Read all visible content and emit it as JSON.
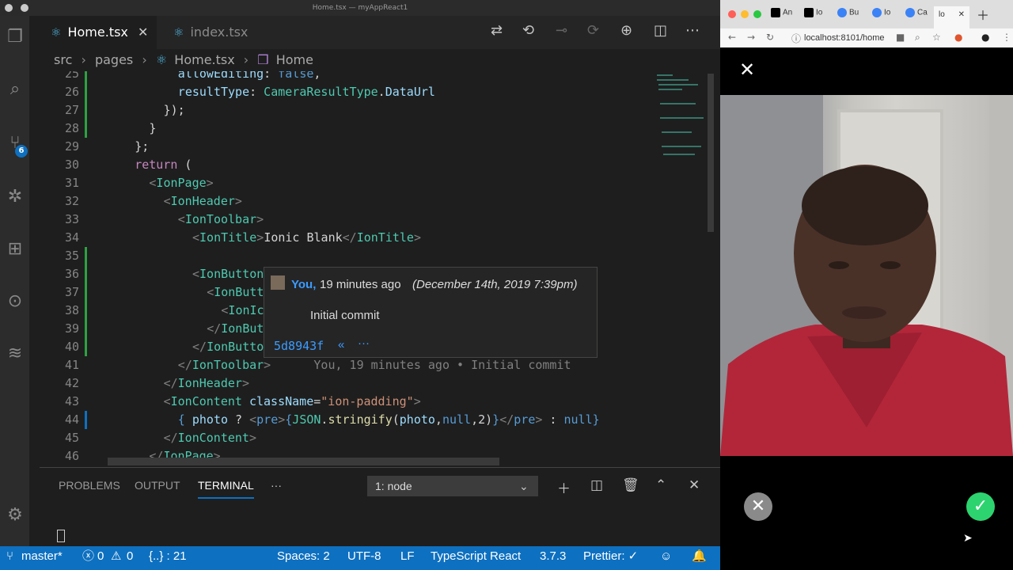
{
  "window_title": "Home.tsx — myAppReact1",
  "activity_bar": {
    "scm_badge": "6"
  },
  "tabs": [
    {
      "label": "Home.tsx",
      "active": true
    },
    {
      "label": "index.tsx",
      "active": false
    }
  ],
  "breadcrumb": {
    "parts": [
      "src",
      "pages",
      "Home.tsx",
      "Home"
    ]
  },
  "editor_lines": [
    {
      "n": "25",
      "html": "<span class='a'>allowEditing</span><span class='w'>: </span><span class='b'>false</span><span class='w'>,</span>",
      "indent": 8
    },
    {
      "n": "26",
      "html": "<span class='a'>resultType</span><span class='w'>: </span><span class='t'>CameraResultType</span><span class='w'>.</span><span class='a'>DataUrl</span>",
      "indent": 8
    },
    {
      "n": "27",
      "html": "<span class='w'>});</span>",
      "indent": 6
    },
    {
      "n": "28",
      "html": "<span class='w'>}</span>",
      "indent": 4
    },
    {
      "n": "29",
      "html": "<span class='w'>};</span>",
      "indent": 2
    },
    {
      "n": "30",
      "html": "<span class='k'>return</span><span class='w'> (</span>",
      "indent": 2
    },
    {
      "n": "31",
      "html": "<span class='p'>&lt;</span><span class='t'>IonPage</span><span class='p'>&gt;</span>",
      "indent": 4
    },
    {
      "n": "32",
      "html": "<span class='p'>&lt;</span><span class='t'>IonHeader</span><span class='p'>&gt;</span>",
      "indent": 6
    },
    {
      "n": "33",
      "html": "<span class='p'>&lt;</span><span class='t'>IonToolbar</span><span class='p'>&gt;</span>",
      "indent": 8
    },
    {
      "n": "34",
      "html": "<span class='p'>&lt;</span><span class='t'>IonTitle</span><span class='p'>&gt;</span><span class='w'>Ionic Blank</span><span class='p'>&lt;/</span><span class='t'>IonTitle</span><span class='p'>&gt;</span>",
      "indent": 10
    },
    {
      "n": "35",
      "html": "",
      "indent": 0
    },
    {
      "n": "36",
      "html": "<span class='p'>&lt;</span><span class='t'>IonButtons</span>",
      "indent": 10
    },
    {
      "n": "37",
      "html": "<span class='p'>&lt;</span><span class='t'>IonButto</span>",
      "indent": 12
    },
    {
      "n": "38",
      "html": "<span class='p'>&lt;</span><span class='t'>IonIco</span>",
      "indent": 14
    },
    {
      "n": "39",
      "html": "<span class='p'>&lt;/</span><span class='t'>IonButt</span>",
      "indent": 12
    },
    {
      "n": "40",
      "html": "<span class='p'>&lt;/</span><span class='t'>IonButton</span>",
      "indent": 10
    },
    {
      "n": "41",
      "html": "<span class='p'>&lt;/</span><span class='t'>IonToolbar</span><span class='p'>&gt;</span>      <span class='p'>You, 19 minutes ago • Initial commit</span>",
      "indent": 8
    },
    {
      "n": "42",
      "html": "<span class='p'>&lt;/</span><span class='t'>IonHeader</span><span class='p'>&gt;</span>",
      "indent": 6
    },
    {
      "n": "43",
      "html": "<span class='p'>&lt;</span><span class='t'>IonContent</span><span class='w'> </span><span class='a'>className</span><span class='w'>=</span><span class='s'>\"ion-padding\"</span><span class='p'>&gt;</span>",
      "indent": 6
    },
    {
      "n": "44",
      "html": "<span class='b'>{</span><span class='w'> </span><span class='a'>photo</span><span class='w'> ? </span><span class='p'>&lt;</span><span class='b'>pre</span><span class='p'>&gt;</span><span class='b'>{</span><span class='t'>JSON</span><span class='w'>.</span><span class='y'>stringify</span><span class='w'>(</span><span class='a'>photo</span><span class='w'>,</span><span class='b'>null</span><span class='w'>,2)</span><span class='b'>}</span><span class='p'>&lt;/</span><span class='b'>pre</span><span class='p'>&gt;</span><span class='w'> : </span><span class='b'>null</span><span class='b'>}</span>",
      "indent": 8
    },
    {
      "n": "45",
      "html": "<span class='p'>&lt;/</span><span class='t'>IonContent</span><span class='p'>&gt;</span>",
      "indent": 6
    },
    {
      "n": "46",
      "html": "<span class='p'>&lt;/</span><span class='t'>IonPage</span><span class='p'>&gt;</span>",
      "indent": 4
    }
  ],
  "blame_hover": {
    "author": "You,",
    "ago": "19 minutes ago",
    "date": "(December 14th, 2019 7:39pm)",
    "message": "Initial commit",
    "sha": "5d8943f",
    "prev": "«",
    "more": "···"
  },
  "panel": {
    "tabs": [
      "PROBLEMS",
      "OUTPUT",
      "TERMINAL"
    ],
    "more": "···",
    "terminal_select": "1: node"
  },
  "statusbar": {
    "branch": "master*",
    "errors": "0",
    "warnings": "0",
    "symbol": "{..} : 21",
    "spaces": "Spaces: 2",
    "encoding": "UTF-8",
    "eol": "LF",
    "language": "TypeScript React",
    "version": "3.7.3",
    "prettier": "Prettier: ✓"
  },
  "browser": {
    "tabs": [
      "An",
      "Io",
      "Bu",
      "Io",
      "Ca",
      "lo"
    ],
    "url": "localhost:8101/home"
  }
}
